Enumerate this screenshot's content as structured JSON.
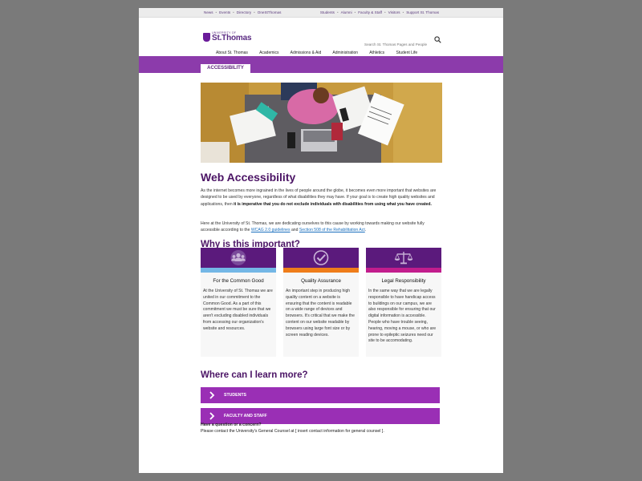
{
  "utility": {
    "left_links": [
      "News",
      "Events",
      "Directory",
      "OneStThomas"
    ],
    "right_links": [
      "Students",
      "Alumni",
      "Faculty & Staff",
      "Visitors",
      "Support St. Thomas"
    ],
    "separator": "•"
  },
  "logo": {
    "university_of": "UNIVERSITY OF",
    "name": "St.Thomas",
    "brand_color": "#5a2a82"
  },
  "search": {
    "placeholder": "Search St. Thomas Pages and People"
  },
  "nav": {
    "items": [
      "About St. Thomas",
      "Academics",
      "Admissions & Aid",
      "Administration",
      "Athletics",
      "Student Life"
    ]
  },
  "section_tab": {
    "label": "ACCESSIBILITY"
  },
  "main": {
    "title": "Web Accessibility",
    "intro": {
      "text1": "As the internet becomes more ingrained in the lives of people around the globe, it becomes even more important that websites are designed to be used by everyone, regardless of what disabilities they may have. If your goal is to create high quality websites and applications, then ",
      "bold": "it is imperative that you do not exclude individuals with disabilities from using what you have created."
    },
    "p2": {
      "text1": "Here at the University of St. Thomas, we are dedicating ourselves to this cause by working towards making our website fully accessible according to the ",
      "link1": "WCAG 2.0 guidelines",
      "and": " and ",
      "link2": "Section 508 of the Rehabilitation Act",
      "end": "."
    },
    "why_heading": "Why is this important?",
    "cards": [
      {
        "icon": "group-icon",
        "strip_color": "#74b7e6",
        "title": "For the Common Good",
        "body": "At the University of St. Thomas we are united in our commitment to the Common Good. As a part of this commitment we must be sure that we aren't excluding disabled individuals from accessing our organization's website and resources."
      },
      {
        "icon": "checkmark-circle-icon",
        "strip_color": "#ef7d1a",
        "title": "Quality Assurance",
        "body": "An important step in producing high quality content on a website is ensuring that the content is readable on a wide range of devices and browsers. It's critical that we make the content on our website readable by browsers using large font size or by screen reading devices."
      },
      {
        "icon": "scales-icon",
        "strip_color": "#c21d8d",
        "title": "Legal Responsibility",
        "body": "In the same way that we are legally responsible to have handicap access to buildings on our campus, we are also responsible for ensuring that our digital information is accessible. People who have trouble seeing, hearing, moving a mouse, or who are prone to epileptic seizures need our site to be accomodating."
      }
    ],
    "learn_heading": "Where can I learn more?",
    "buttons": [
      "STUDENTS",
      "FACULTY AND STAFF"
    ],
    "question": "Have a question or a concern?",
    "contact": "Please contact the University's General Counsel at [ insert contact information for general counsel ]."
  },
  "colors": {
    "band": "#8c3bab",
    "heading": "#4b1465",
    "card_header": "#5b1a7c",
    "button": "#9a2fb5",
    "link": "#1a6fbd"
  }
}
